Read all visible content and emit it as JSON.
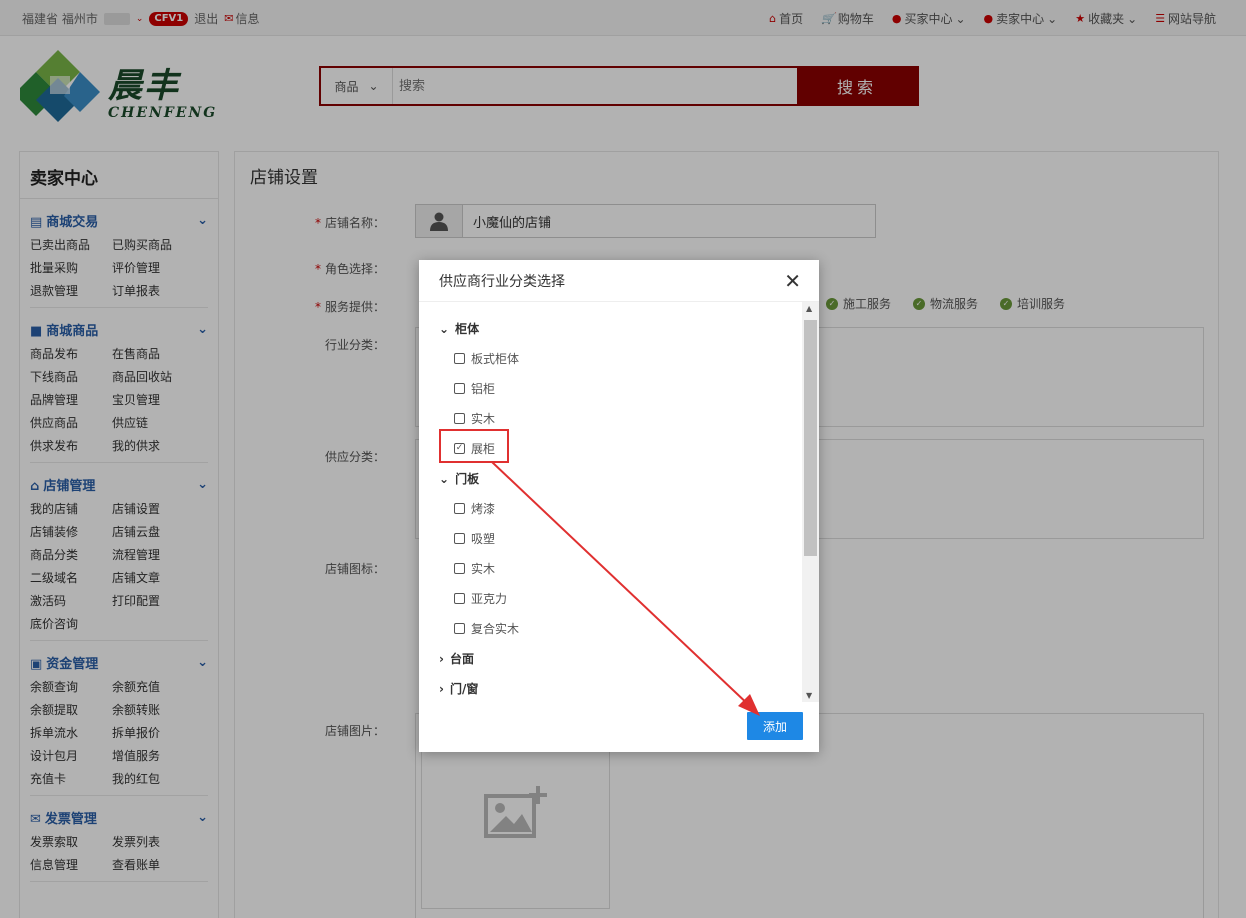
{
  "topbar": {
    "location": "福建省 福州市",
    "badge": "CFV1",
    "logout": "退出",
    "messages": "信息",
    "nav": [
      "首页",
      "购物车",
      "买家中心",
      "卖家中心",
      "收藏夹",
      "网站导航"
    ]
  },
  "logo": {
    "cn": "晨丰",
    "en": "CHENFENG"
  },
  "search": {
    "category": "商品",
    "placeholder": "搜索",
    "button": "搜索"
  },
  "sidebar": {
    "title": "卖家中心",
    "sections": [
      {
        "title": "商城交易",
        "icon": "list-icon",
        "links": [
          "已卖出商品",
          "已购买商品",
          "批量采购",
          "评价管理",
          "退款管理",
          "订单报表"
        ]
      },
      {
        "title": "商城商品",
        "icon": "truck-icon",
        "links": [
          "商品发布",
          "在售商品",
          "下线商品",
          "商品回收站",
          "品牌管理",
          "宝贝管理",
          "供应商品",
          "供应链",
          "供求发布",
          "我的供求"
        ]
      },
      {
        "title": "店铺管理",
        "icon": "home-icon",
        "links": [
          "我的店铺",
          "店铺设置",
          "店铺装修",
          "店铺云盘",
          "商品分类",
          "流程管理",
          "二级域名",
          "店铺文章",
          "激活码",
          "打印配置",
          "底价咨询"
        ]
      },
      {
        "title": "资金管理",
        "icon": "money-icon",
        "links": [
          "余额查询",
          "余额充值",
          "余额提取",
          "余额转账",
          "拆单流水",
          "拆单报价",
          "设计包月",
          "增值服务",
          "充值卡",
          "我的红包"
        ]
      },
      {
        "title": "发票管理",
        "icon": "envelope-icon",
        "links": [
          "发票索取",
          "发票列表",
          "信息管理",
          "查看账单"
        ]
      }
    ]
  },
  "main": {
    "title": "店铺设置",
    "labels": {
      "shop_name": "店铺名称：",
      "role": "角色选择：",
      "service": "服务提供：",
      "industry": "行业分类：",
      "supply": "供应分类：",
      "icon": "店铺图标：",
      "image": "店铺图片："
    },
    "shop_name_value": "小魔仙的店铺",
    "services": [
      "施工服务",
      "物流服务",
      "培训服务"
    ]
  },
  "modal": {
    "title": "供应商行业分类选择",
    "add_button": "添加",
    "tree": [
      {
        "label": "柜体",
        "expanded": true,
        "children": [
          {
            "label": "板式柜体",
            "checked": false
          },
          {
            "label": "铝柜",
            "checked": false
          },
          {
            "label": "实木",
            "checked": false
          },
          {
            "label": "展柜",
            "checked": true
          }
        ]
      },
      {
        "label": "门板",
        "expanded": true,
        "children": [
          {
            "label": "烤漆",
            "checked": false
          },
          {
            "label": "吸塑",
            "checked": false
          },
          {
            "label": "实木",
            "checked": false
          },
          {
            "label": "亚克力",
            "checked": false
          },
          {
            "label": "复合实木",
            "checked": false
          }
        ]
      },
      {
        "label": "台面",
        "expanded": false
      },
      {
        "label": "门/窗",
        "expanded": false
      }
    ]
  }
}
